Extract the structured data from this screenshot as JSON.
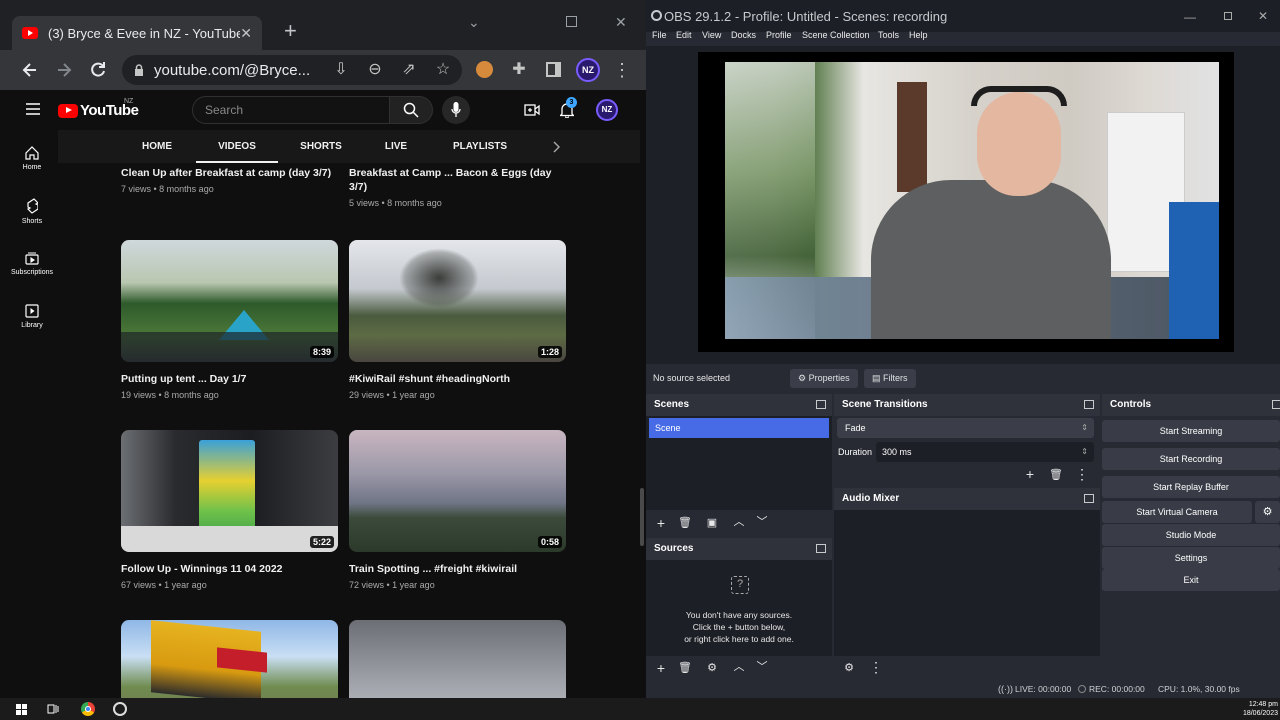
{
  "chrome": {
    "tab_title": "(3) Bryce & Evee in NZ - YouTube",
    "url": "youtube.com/@Bryce...",
    "profile_badge": "NZ"
  },
  "youtube": {
    "logo_text": "YouTube",
    "country": "NZ",
    "search_placeholder": "Search",
    "notif_count": "3",
    "sidebar": [
      {
        "label": "Home"
      },
      {
        "label": "Shorts"
      },
      {
        "label": "Subscriptions"
      },
      {
        "label": "Library"
      }
    ],
    "tabs": [
      {
        "label": "HOME"
      },
      {
        "label": "VIDEOS"
      },
      {
        "label": "SHORTS"
      },
      {
        "label": "LIVE"
      },
      {
        "label": "PLAYLISTS"
      }
    ],
    "videos": [
      {
        "title": "Clean Up after Breakfast at camp (day 3/7)",
        "meta": "7 views • 8 months ago",
        "duration": ""
      },
      {
        "title": "Breakfast at Camp ... Bacon & Eggs (day 3/7)",
        "meta": "5 views • 8 months ago",
        "duration": ""
      },
      {
        "title": "Putting up tent ... Day 1/7",
        "meta": "19 views • 8 months ago",
        "duration": "8:39"
      },
      {
        "title": "#KiwiRail #shunt #headingNorth",
        "meta": "29 views • 1 year ago",
        "duration": "1:28"
      },
      {
        "title": "Follow Up - Winnings 11 04 2022",
        "meta": "67 views • 1 year ago",
        "duration": "5:22"
      },
      {
        "title": "Train Spotting ... #freight #kiwirail",
        "meta": "72 views • 1 year ago",
        "duration": "0:58"
      }
    ]
  },
  "obs": {
    "title": "OBS 29.1.2 - Profile: Untitled - Scenes: recording",
    "menu": [
      "File",
      "Edit",
      "View",
      "Docks",
      "Profile",
      "Scene Collection",
      "Tools",
      "Help"
    ],
    "no_source": "No source selected",
    "properties_label": "Properties",
    "filters_label": "Filters",
    "scenes_title": "Scenes",
    "scene_items": [
      "Scene"
    ],
    "sources_title": "Sources",
    "sources_empty": [
      "You don't have any sources.",
      "Click the + button below,",
      "or right click here to add one."
    ],
    "transitions_title": "Scene Transitions",
    "transition": "Fade",
    "duration_label": "Duration",
    "duration_value": "300 ms",
    "mixer_title": "Audio Mixer",
    "controls_title": "Controls",
    "controls": {
      "start_streaming": "Start Streaming",
      "start_recording": "Start Recording",
      "replay_buffer": "Start Replay Buffer",
      "virtual_camera": "Start Virtual Camera",
      "studio_mode": "Studio Mode",
      "settings": "Settings",
      "exit": "Exit"
    },
    "status": {
      "live": "LIVE: 00:00:00",
      "rec": "REC: 00:00:00",
      "cpu": "CPU: 1.0%, 30.00 fps"
    }
  },
  "taskbar": {
    "time": "12:48 pm",
    "date": "18/06/2023"
  }
}
